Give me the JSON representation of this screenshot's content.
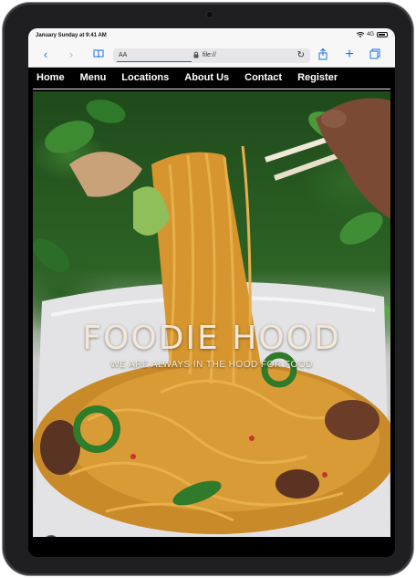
{
  "status_bar": {
    "date_time": "January Sunday at 9:41 AM",
    "signal": "4G",
    "battery_percent": 100
  },
  "browser": {
    "text_size_label": "AA",
    "url": "file://"
  },
  "nav": {
    "items": [
      {
        "label": "Home"
      },
      {
        "label": "Menu"
      },
      {
        "label": "Locations"
      },
      {
        "label": "About Us"
      },
      {
        "label": "Contact"
      },
      {
        "label": "Register"
      }
    ]
  },
  "hero": {
    "title": "FOODIE HOOD",
    "subtitle": "WE ARE ALWAYS IN THE HOOD FOR FOOD"
  },
  "icons": {
    "back": "chevron-left-icon",
    "forward": "chevron-right-icon",
    "reader": "book-icon",
    "share": "share-icon",
    "new_tab": "plus-icon",
    "tabs": "tabs-icon",
    "reload": "reload-icon",
    "lock": "lock-icon",
    "user": "user-icon"
  },
  "colors": {
    "accent": "#1a73e8",
    "nav_background": "#000000",
    "nav_text": "#ffffff",
    "title_text": "#f3e7d6"
  }
}
